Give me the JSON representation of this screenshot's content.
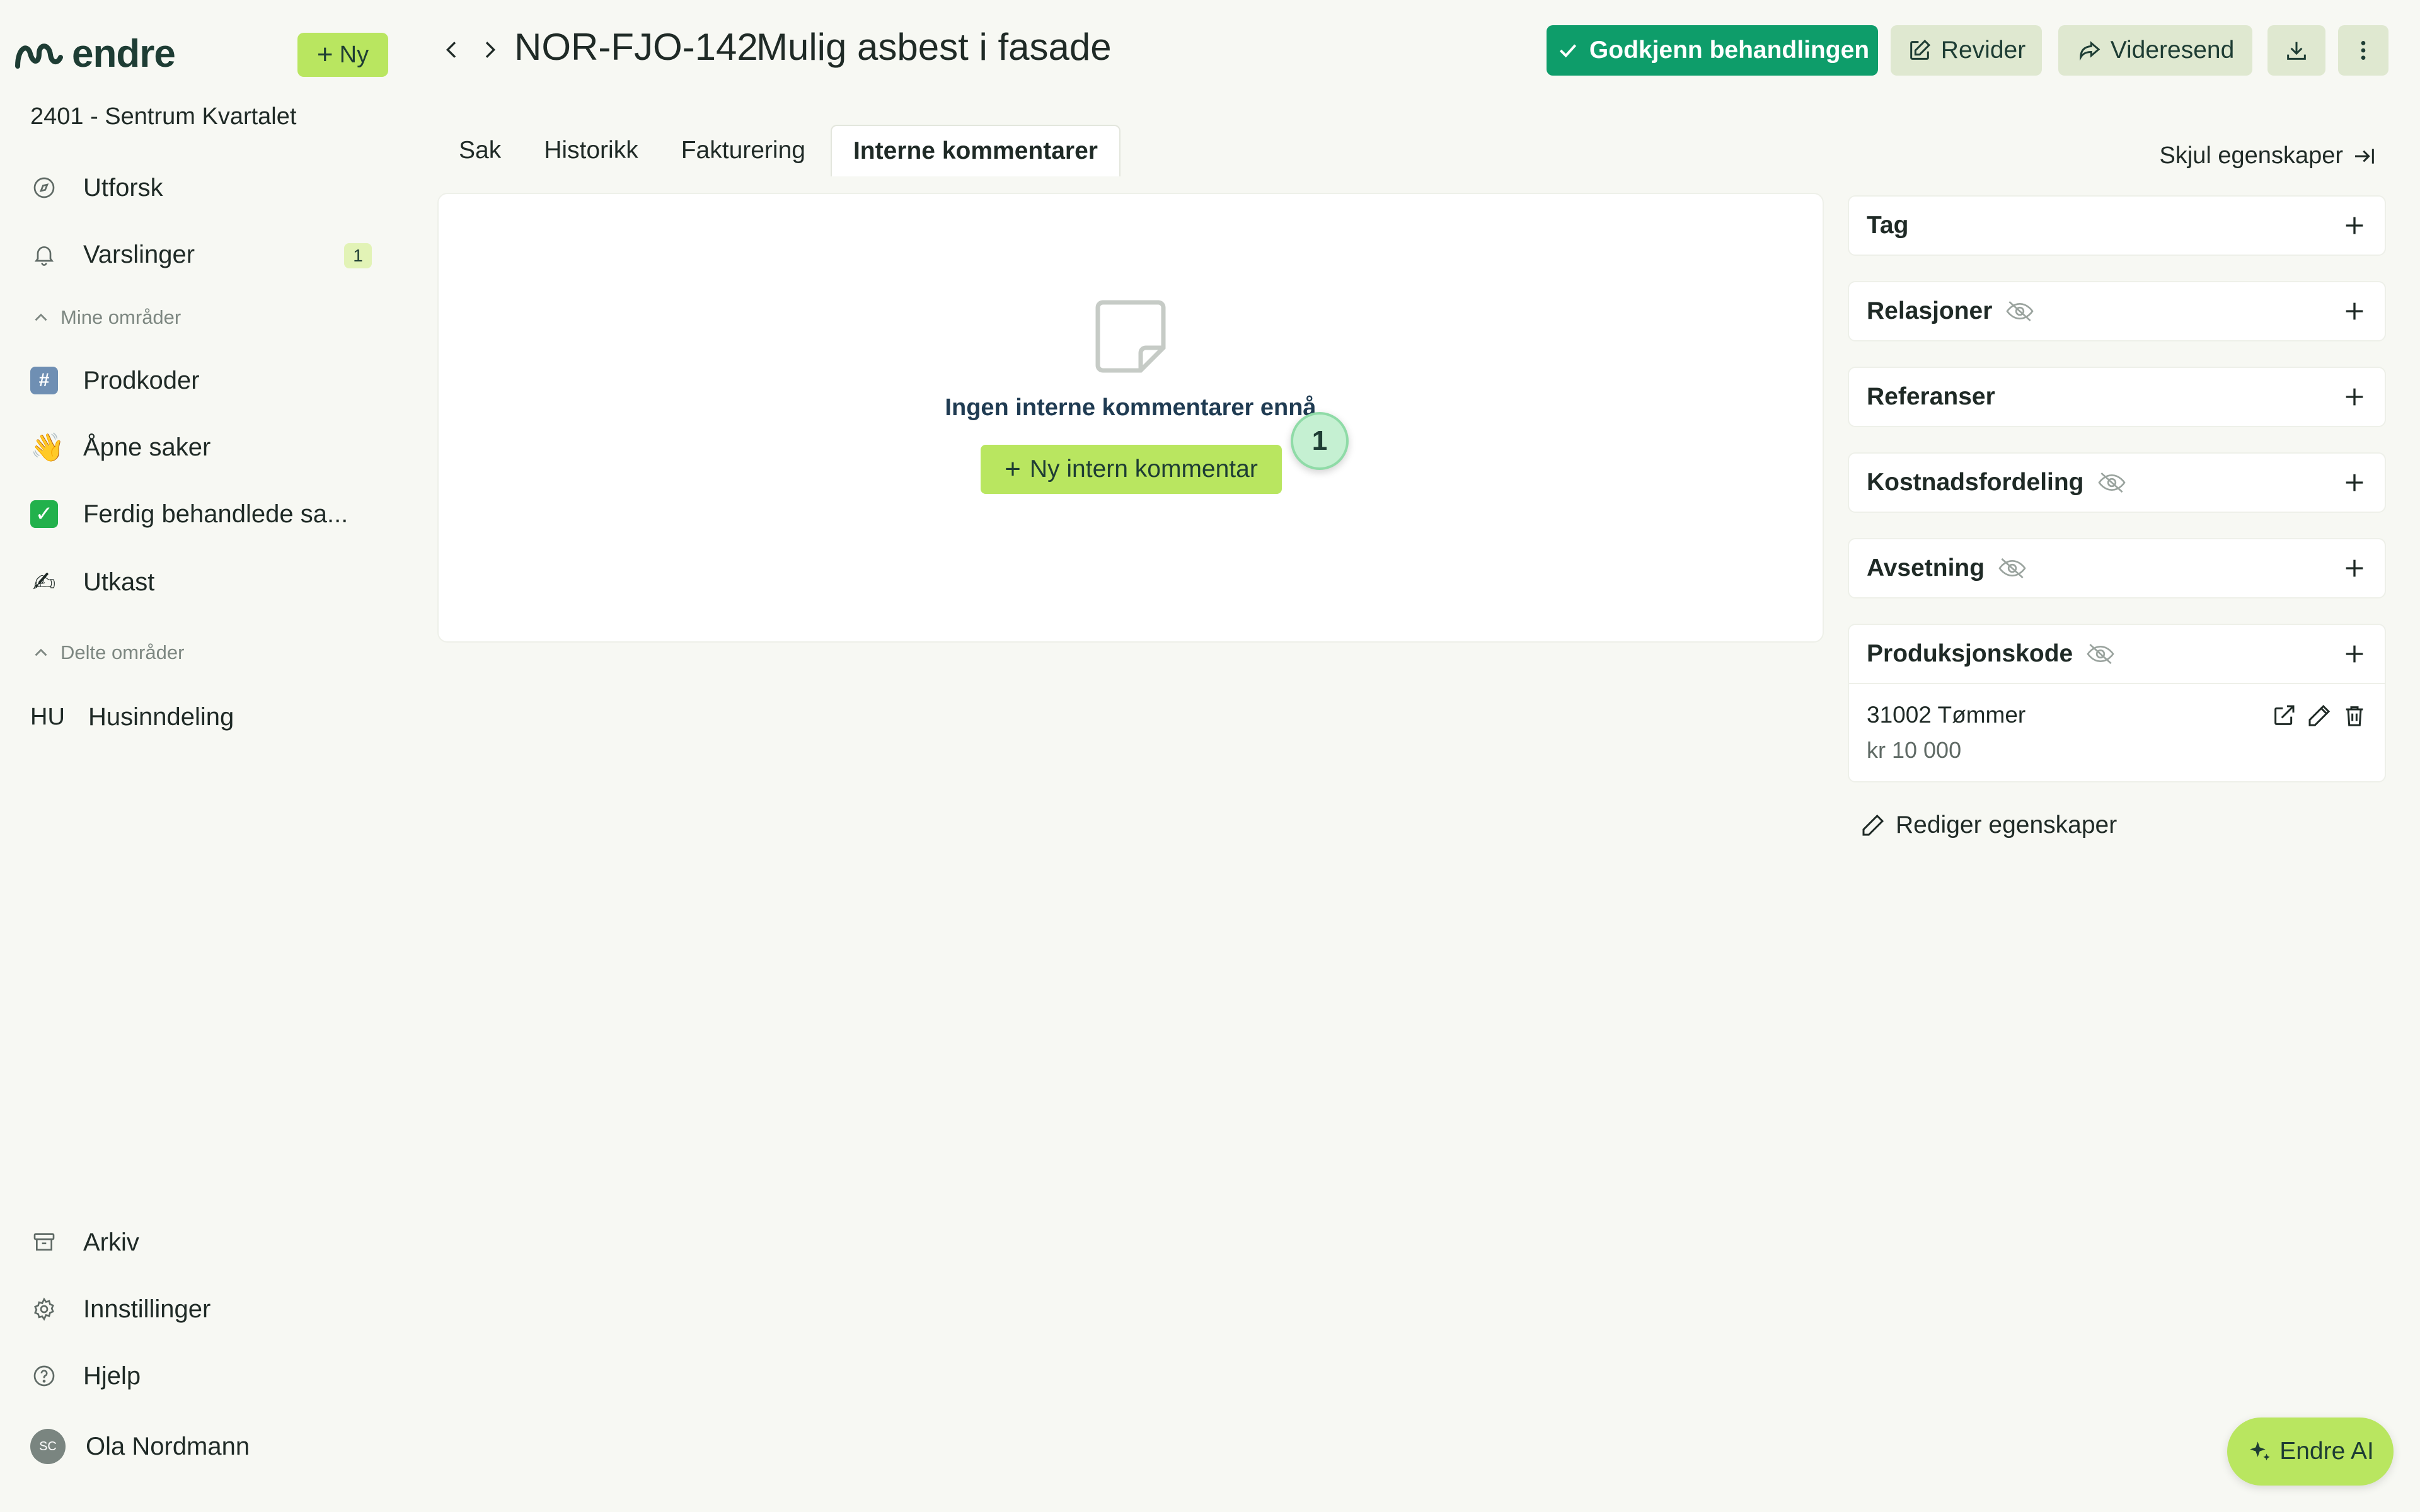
{
  "app": {
    "logo_text": "endre",
    "new_button": "Ny"
  },
  "sidebar": {
    "org": "2401 - Sentrum Kvartalet",
    "top_items": [
      {
        "label": "Utforsk",
        "icon": "compass-icon"
      },
      {
        "label": "Varslinger",
        "icon": "bell-icon",
        "badge": "1"
      }
    ],
    "my_areas_label": "Mine områder",
    "my_areas": [
      {
        "label": "Prodkoder",
        "icon": "hash-icon",
        "glyph": "#"
      },
      {
        "label": "Åpne saker",
        "icon": "waving-hand-icon",
        "glyph": "👋"
      },
      {
        "label": "Ferdig behandlede sa...",
        "icon": "check-box-icon",
        "glyph": "✓"
      },
      {
        "label": "Utkast",
        "icon": "writing-hand-icon",
        "glyph": "✍"
      }
    ],
    "shared_areas_label": "Delte områder",
    "shared_areas": [
      {
        "abbr": "HU",
        "label": "Husinndeling"
      }
    ],
    "bottom_items": [
      {
        "label": "Arkiv",
        "icon": "archive-icon"
      },
      {
        "label": "Innstillinger",
        "icon": "gear-icon"
      },
      {
        "label": "Hjelp",
        "icon": "help-icon"
      }
    ],
    "user": {
      "initials": "SC",
      "name": "Ola Nordmann"
    }
  },
  "header": {
    "case_id": "NOR-FJO-142",
    "case_title": "Mulig asbest i fasade",
    "approve": "Godkjenn behandlingen",
    "revise": "Revider",
    "forward": "Videresend"
  },
  "tabs": [
    "Sak",
    "Historikk",
    "Fakturering",
    "Interne kommentarer"
  ],
  "active_tab": "Interne kommentarer",
  "hide_properties": "Skjul egenskaper",
  "main": {
    "empty_text": "Ingen interne kommentarer ennå",
    "new_comment": "Ny intern kommentar",
    "step_marker": "1"
  },
  "properties": [
    {
      "title": "Tag",
      "hidden": false
    },
    {
      "title": "Relasjoner",
      "hidden": true
    },
    {
      "title": "Referanser",
      "hidden": false
    },
    {
      "title": "Kostnadsfordeling",
      "hidden": true
    },
    {
      "title": "Avsetning",
      "hidden": true
    },
    {
      "title": "Produksjonskode",
      "hidden": true,
      "row": {
        "code": "31002 Tømmer",
        "amount": "kr 10 000"
      }
    }
  ],
  "edit_properties": "Rediger egenskaper",
  "ai_button": "Endre AI",
  "colors": {
    "primary": "#0e9d6a",
    "accent": "#b9e660",
    "background": "#f7f8f3",
    "card": "#ffffff"
  }
}
